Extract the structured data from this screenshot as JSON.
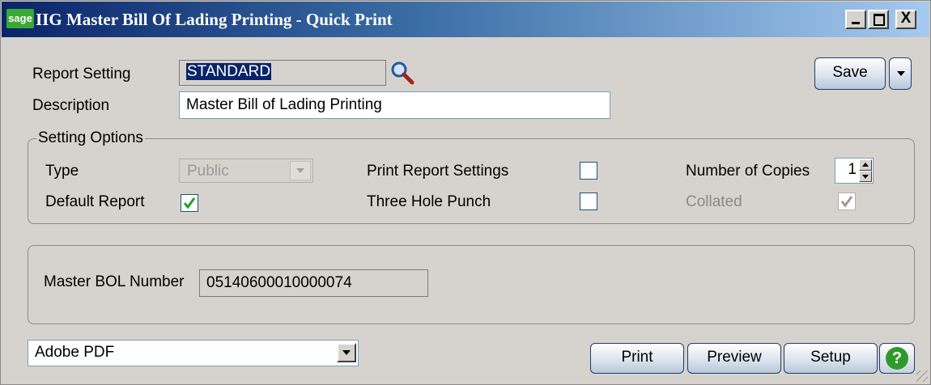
{
  "window": {
    "logo": "sage",
    "title": "IIG Master Bill Of Lading Printing - Quick Print",
    "controls": {
      "minimize": "_",
      "maximize": "□",
      "close": "X"
    }
  },
  "report_setting": {
    "label": "Report Setting",
    "value": "STANDARD",
    "lookup_icon": "magnifier-icon"
  },
  "description": {
    "label": "Description",
    "value": "Master Bill of Lading Printing"
  },
  "save": {
    "label": "Save",
    "accel": "a",
    "menu_icon": "chevron-down-icon"
  },
  "setting_options": {
    "legend": "Setting Options",
    "type_label": "Type",
    "type_value": "Public",
    "default_report_label": "Default Report",
    "default_report_checked": true,
    "print_report_settings_label": "Print Report Settings",
    "print_report_settings_checked": false,
    "three_hole_punch_label": "Three Hole Punch",
    "three_hole_punch_checked": false,
    "copies_label": "Number of Copies",
    "copies_value": "1",
    "collated_label": "Collated",
    "collated_checked": true
  },
  "master_bol": {
    "label": "Master BOL Number",
    "value": "05140600010000074"
  },
  "printer": {
    "value": "Adobe PDF"
  },
  "buttons": {
    "print": "Print",
    "preview": "Preview",
    "setup": "Setup",
    "help": "?"
  },
  "colors": {
    "title_start": "#0a246a",
    "title_end": "#a6caf0",
    "background": "#d6d3ce",
    "selection": "#0a246a",
    "help_green": "#2f9a2c"
  }
}
